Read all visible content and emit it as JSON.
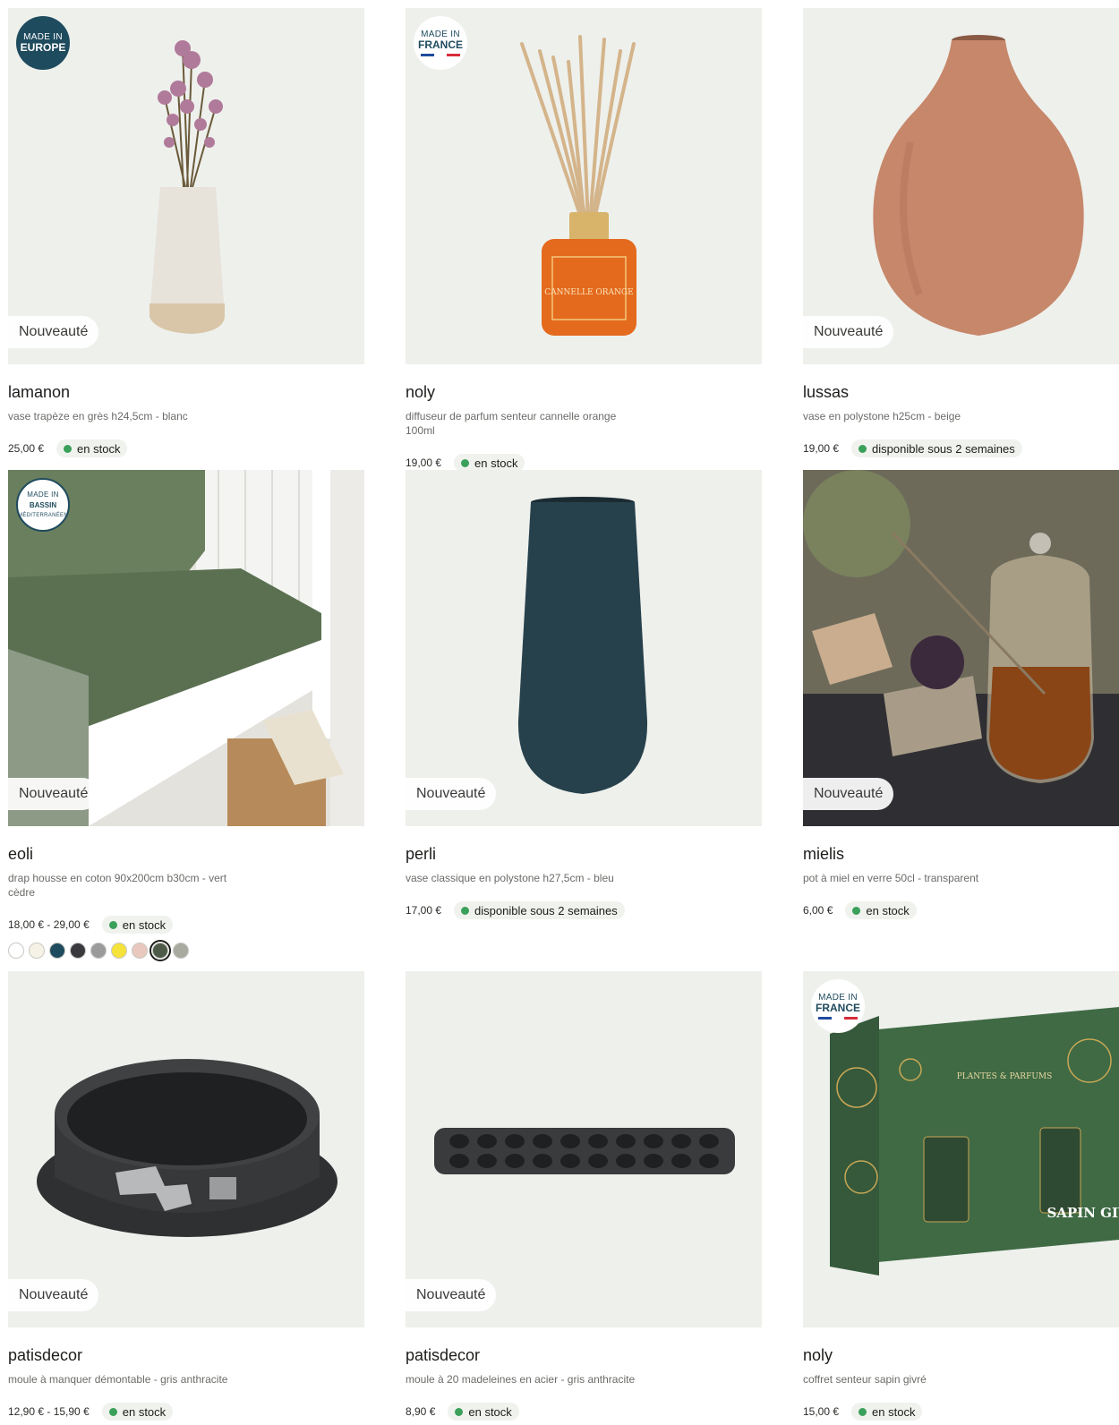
{
  "badges": {
    "new": "Nouveauté"
  },
  "origin": {
    "europe": {
      "top": "MADE IN",
      "bottom": "EUROPE"
    },
    "france": {
      "top": "MADE IN",
      "bottom": "FRANCE"
    },
    "bassin": {
      "top": "MADE IN",
      "middle": "BASSIN",
      "bottom": "MÉDITERRANÉEN"
    }
  },
  "colors": {
    "stock_dot": "#3aa05a",
    "card_bg": "#eef0ec",
    "origin_blue": "#1f4b5e"
  },
  "products": [
    {
      "name": "lamanon",
      "desc": "vase trapèze en grès h24,5cm - blanc",
      "price": "25,00 €",
      "stock": "en stock"
    },
    {
      "name": "noly",
      "desc": "diffuseur de parfum senteur cannelle orange 100ml",
      "price": "19,00 €",
      "stock": "en stock"
    },
    {
      "name": "lussas",
      "desc": "vase en polystone h25cm - beige",
      "price": "19,00 €",
      "stock": "disponible sous 2 semaines"
    },
    {
      "name": "eoli",
      "desc": "drap housse en coton 90x200cm b30cm - vert cèdre",
      "price": "18,00 € - 29,00 €",
      "stock": "en stock",
      "swatches": [
        "#ffffff",
        "#f6f3e6",
        "#1f4b5e",
        "#3a3a3e",
        "#9b9b9b",
        "#f5e23a",
        "#e9c9bd",
        "#4d5a48",
        "#a8aaa0"
      ],
      "selected_swatch": 7
    },
    {
      "name": "perli",
      "desc": "vase classique en polystone h27,5cm - bleu",
      "price": "17,00 €",
      "stock": "disponible sous 2 semaines"
    },
    {
      "name": "mielis",
      "desc": "pot à miel en verre 50cl - transparent",
      "price": "6,00 €",
      "stock": "en stock"
    },
    {
      "name": "patisdecor",
      "desc": "moule à manquer démontable - gris anthracite",
      "price": "12,90 € - 15,90 €",
      "stock": "en stock"
    },
    {
      "name": "patisdecor",
      "desc": "moule à 20 madeleines en acier - gris anthracite",
      "price": "8,90 €",
      "stock": "en stock"
    },
    {
      "name": "noly",
      "desc": "coffret senteur sapin givré",
      "price": "15,00 €",
      "stock": "en stock"
    }
  ],
  "artwork_text": {
    "diffuser_label": "CANNELLE ORANGE",
    "giftbox_brand": "PLANTES & PARFUMS",
    "giftbox_title": "SAPIN GIVRÉ"
  }
}
